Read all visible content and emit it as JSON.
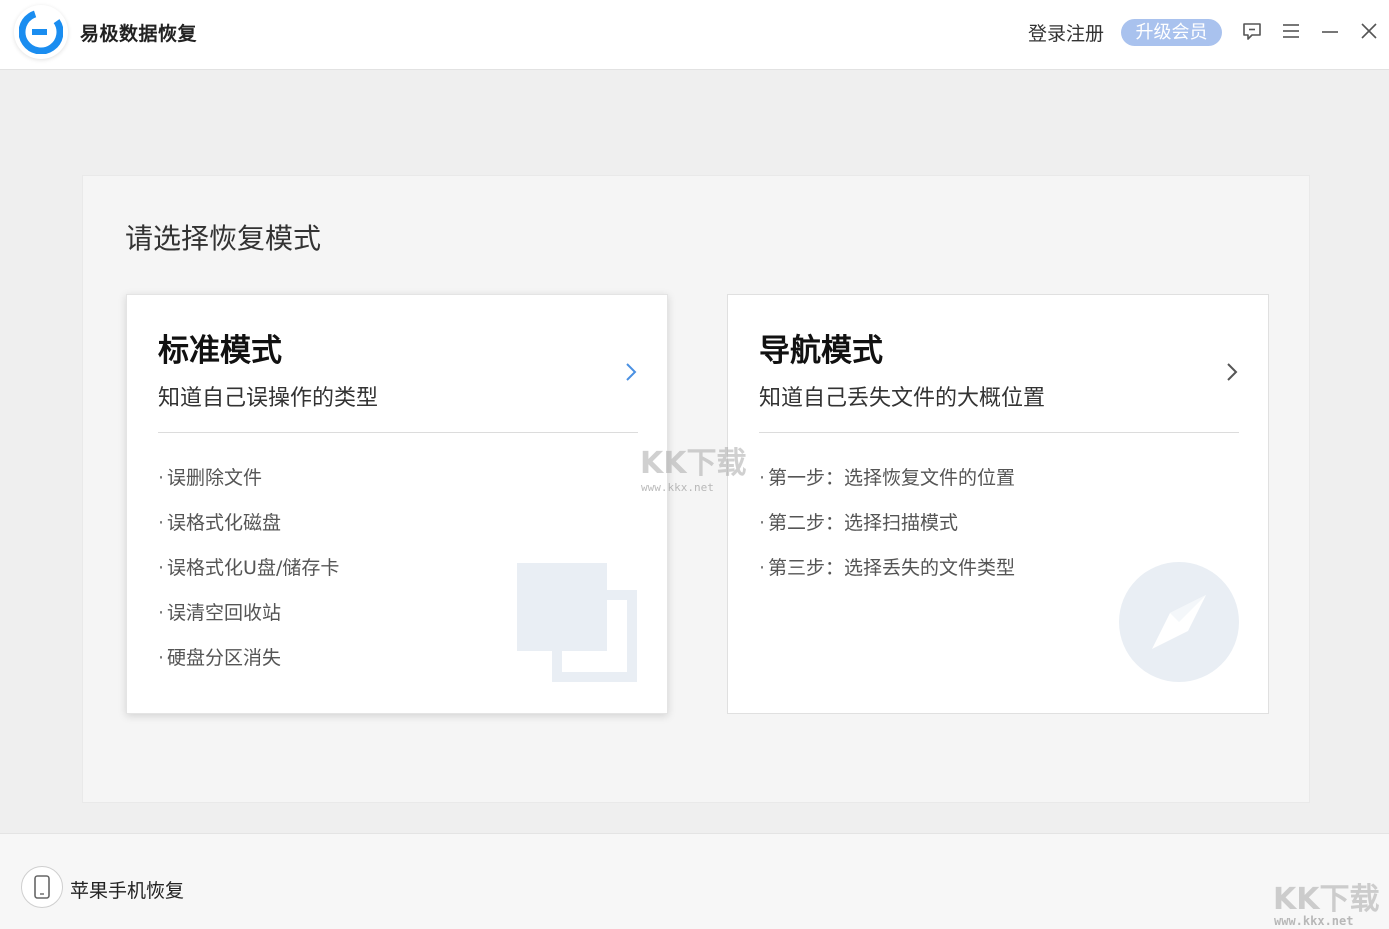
{
  "titlebar": {
    "app_name": "易极数据恢复",
    "login_label": "登录注册",
    "upgrade_label": "升级会员",
    "icons": [
      "feedback-icon",
      "menu-icon",
      "minimize-icon",
      "close-icon"
    ]
  },
  "main": {
    "heading": "请选择恢复模式",
    "modes": [
      {
        "title": "标准模式",
        "subtitle": "知道自己误操作的类型",
        "items": [
          "误删除文件",
          "误格式化磁盘",
          "误格式化U盘/储存卡",
          "误清空回收站",
          "硬盘分区消失"
        ],
        "icon": "copy-illustration-icon",
        "arrow_color": "#4a90e2"
      },
      {
        "title": "导航模式",
        "subtitle": "知道自己丢失文件的大概位置",
        "items": [
          "第一步：选择恢复文件的位置",
          "第二步：选择扫描模式",
          "第三步：选择丢失的文件类型"
        ],
        "icon": "compass-illustration-icon",
        "arrow_color": "#555555"
      }
    ]
  },
  "footer": {
    "iphone_label": "苹果手机恢复"
  },
  "watermark": {
    "text": "KK下载",
    "url": "www.kkx.net"
  },
  "colors": {
    "brand_blue": "#1a8df0",
    "upgrade_bg": "#a9c2ee",
    "illustration": "#e9eef4"
  }
}
